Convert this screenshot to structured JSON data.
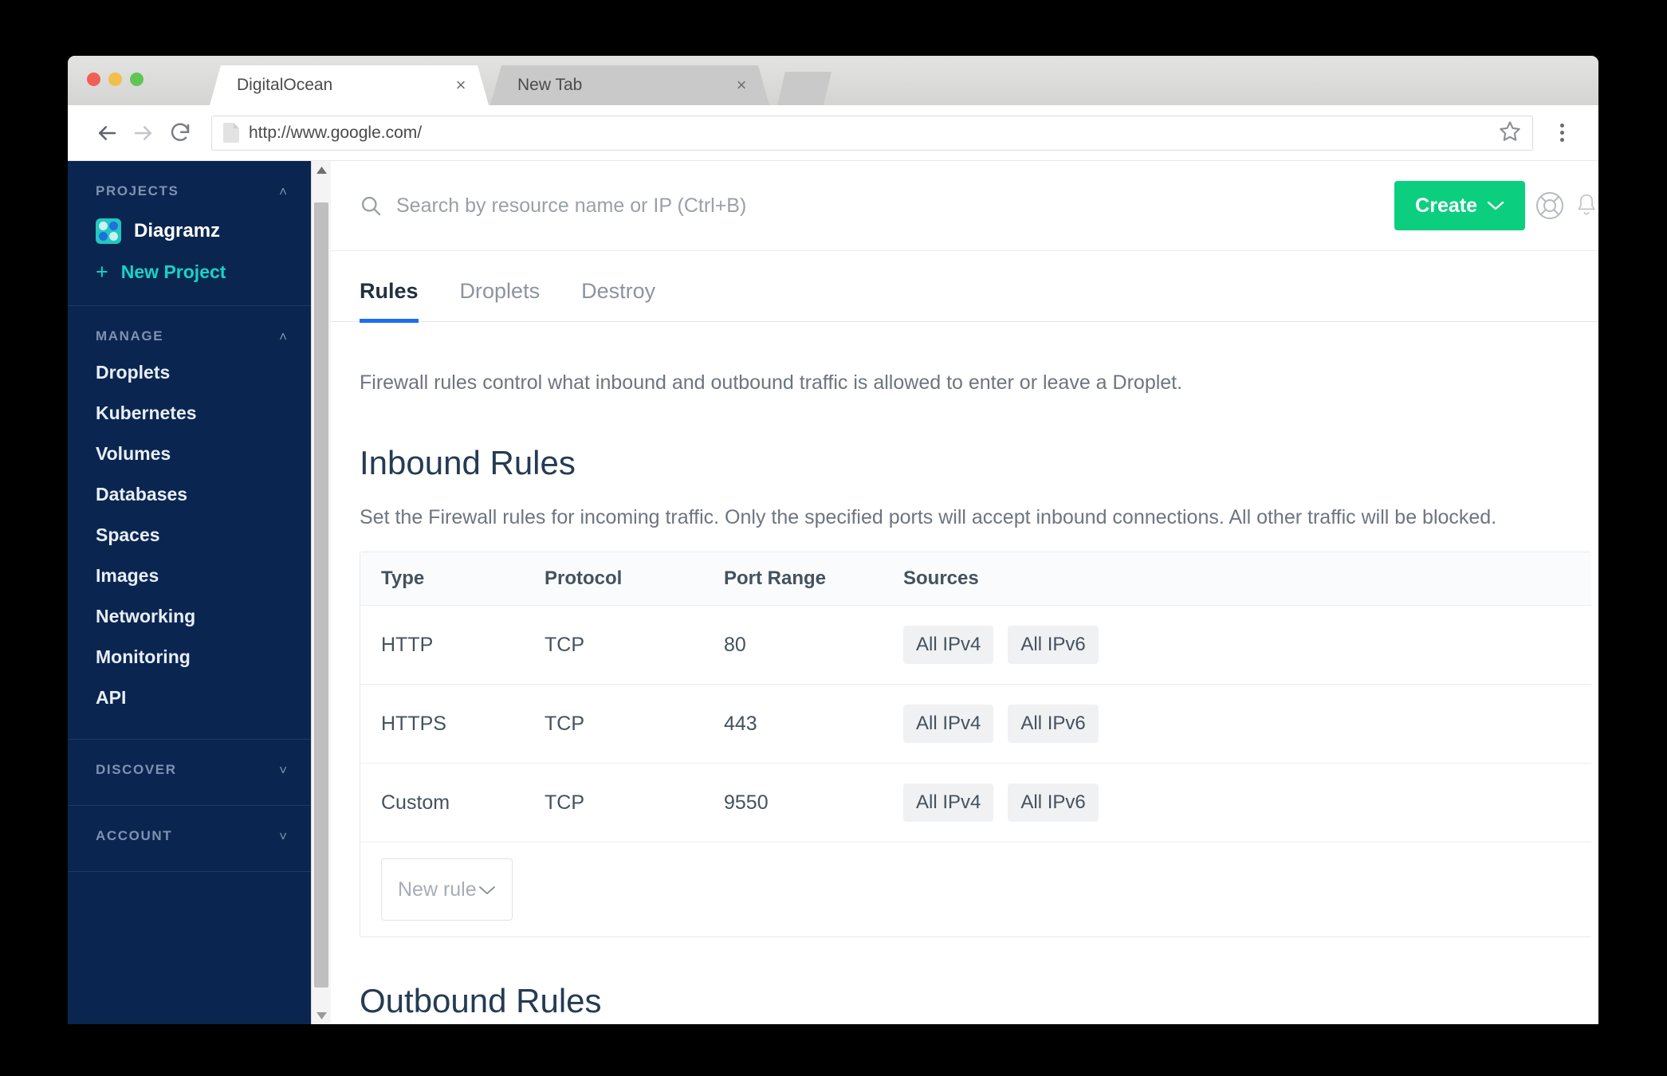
{
  "browser": {
    "tabs": [
      {
        "title": "DigitalOcean",
        "close": "×",
        "active": true
      },
      {
        "title": "New Tab",
        "close": "×",
        "active": false
      }
    ],
    "url": "http://www.google.com/",
    "nav": {
      "back": "back-arrow",
      "forward": "forward-arrow",
      "reload": "reload-icon",
      "bookmark": "star-icon",
      "menu": "kebab-menu-icon"
    }
  },
  "sidebar": {
    "projects": {
      "title": "PROJECTS",
      "chevron": "˄",
      "project_name": "Diagramz",
      "new_project": "New Project",
      "plus": "+"
    },
    "manage": {
      "title": "MANAGE",
      "chevron": "˄",
      "items": [
        {
          "label": "Droplets"
        },
        {
          "label": "Kubernetes"
        },
        {
          "label": "Volumes"
        },
        {
          "label": "Databases"
        },
        {
          "label": "Spaces"
        },
        {
          "label": "Images"
        },
        {
          "label": "Networking"
        },
        {
          "label": "Monitoring"
        },
        {
          "label": "API"
        }
      ]
    },
    "discover": {
      "title": "DISCOVER",
      "chevron": "˅"
    },
    "account": {
      "title": "ACCOUNT",
      "chevron": "˅"
    }
  },
  "topbar": {
    "search_placeholder": "Search by resource name or IP (Ctrl+B)",
    "create_label": "Create",
    "create_chevron": "⌄",
    "create_color": "#0bcf7f",
    "help_icon": "lifesaver-icon",
    "notifications_icon": "bell-icon"
  },
  "tabs": [
    {
      "label": "Rules",
      "active": true
    },
    {
      "label": "Droplets",
      "active": false
    },
    {
      "label": "Destroy",
      "active": false
    }
  ],
  "main": {
    "lede": "Firewall rules control what inbound and outbound traffic is allowed to enter or leave a Droplet.",
    "inbound": {
      "heading": "Inbound Rules",
      "description": "Set the Firewall rules for incoming traffic. Only the specified ports will accept inbound connections. All other traffic will be blocked.",
      "columns": [
        "Type",
        "Protocol",
        "Port Range",
        "Sources"
      ],
      "rows": [
        {
          "type": "HTTP",
          "protocol": "TCP",
          "port": "80",
          "sources": [
            "All IPv4",
            "All IPv6"
          ]
        },
        {
          "type": "HTTPS",
          "protocol": "TCP",
          "port": "443",
          "sources": [
            "All IPv4",
            "All IPv6"
          ]
        },
        {
          "type": "Custom",
          "protocol": "TCP",
          "port": "9550",
          "sources": [
            "All IPv4",
            "All IPv6"
          ]
        }
      ],
      "new_rule_label": "New rule",
      "new_rule_chevron": "⌄"
    },
    "outbound": {
      "heading": "Outbound Rules"
    }
  },
  "colors": {
    "sidebar_bg": "#0a2650",
    "accent_green": "#0bcf7f",
    "accent_cyan": "#16d3c8",
    "tab_underline": "#1b6ef3"
  }
}
